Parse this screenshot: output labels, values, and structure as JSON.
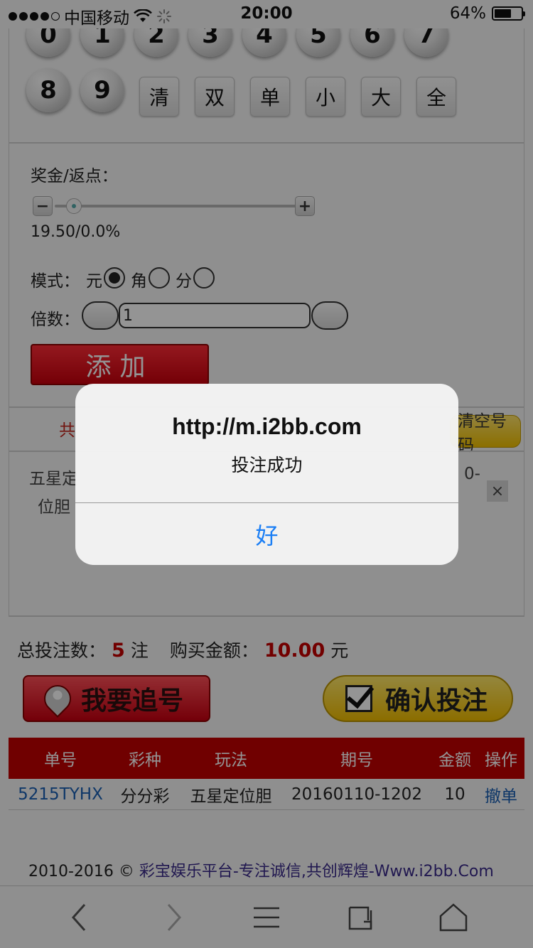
{
  "status_bar": {
    "carrier": "中国移动",
    "time": "20:00",
    "battery": "64%",
    "battery_level": 0.64
  },
  "numbers": {
    "row1": [
      "0",
      "1",
      "2",
      "3",
      "4",
      "5",
      "6",
      "7"
    ],
    "row2": [
      "8",
      "9"
    ],
    "quick": [
      "清",
      "双",
      "单",
      "小",
      "大",
      "全"
    ]
  },
  "bonus": {
    "label": "奖金/返点：",
    "minus": "−",
    "plus": "+",
    "value": "19.50/0.0%",
    "slider_level": 0.03
  },
  "mode": {
    "label": "模式：",
    "options": [
      "元",
      "角",
      "分"
    ],
    "selected": "元"
  },
  "multiplier": {
    "label": "倍数：",
    "value": "1"
  },
  "add_button": "添加",
  "summary": {
    "tab_text": "共",
    "clear_button": "清空号码",
    "entry_left1": "五星定",
    "entry_left2": "位胆",
    "entry_right": "0-",
    "close": "×"
  },
  "totals": {
    "bets_label": "总投注数：",
    "bets_value": "5",
    "bets_unit": "注",
    "amount_label": "购买金额：",
    "amount_value": "10.00",
    "amount_unit": "元"
  },
  "actions": {
    "chase": "我要追号",
    "confirm": "确认投注"
  },
  "table": {
    "headers": [
      "单号",
      "彩种",
      "玩法",
      "期号",
      "金额",
      "操作"
    ],
    "rows": [
      [
        "5215TYHX",
        "分分彩",
        "五星定位胆",
        "20160110-1202",
        "10",
        "撤单"
      ]
    ]
  },
  "footer": {
    "copyright": "2010-2016 ©",
    "link": "彩宝娱乐平台-专注诚信,共创辉煌-Www.i2bb.Com"
  },
  "alert": {
    "title": "http://m.i2bb.com",
    "message": "投注成功",
    "button": "好"
  },
  "toolbar": {
    "icons": [
      "chevron-left-icon",
      "chevron-right-icon",
      "menu-icon",
      "tabs-icon",
      "home-icon"
    ]
  }
}
